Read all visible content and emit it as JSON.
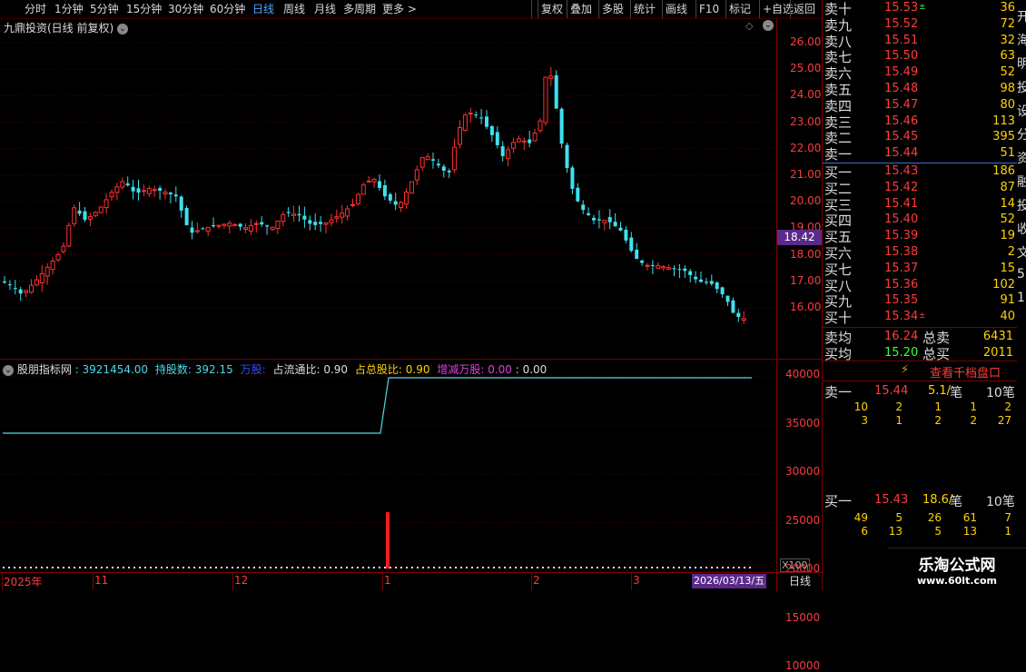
{
  "toolbar": {
    "periods": [
      "分时",
      "1分钟",
      "5分钟",
      "15分钟",
      "30分钟",
      "60分钟",
      "日线",
      "周线",
      "月线",
      "多周期",
      "更多 >"
    ],
    "active_period": "日线",
    "right_buttons": [
      "复权",
      "叠加",
      "多股",
      "统计",
      "画线",
      "F10",
      "标记",
      "+自选",
      "返回"
    ]
  },
  "chart": {
    "title": "九鼎投资(日线 前复权)",
    "price_axis": [
      "26.00",
      "25.00",
      "24.00",
      "23.00",
      "22.00",
      "21.00",
      "20.00",
      "19.00",
      "18.00",
      "17.00",
      "16.00"
    ],
    "current_price_tag": "18.42",
    "date_axis": [
      "2025年",
      "11",
      "12",
      "1",
      "2",
      "3"
    ],
    "cursor_date": "2026/03/13/五",
    "period_label": "日线"
  },
  "indicator": {
    "name": "股朋指标网",
    "value_main": ": 3921454.00",
    "holding_label": "持股数:",
    "holding_value": "392.15",
    "unit_label": "万股:",
    "float_ratio_label": "占流通比:",
    "float_ratio_value": "0.90",
    "total_ratio_label": "占总股比:",
    "total_ratio_value": "0.90",
    "change_label": "增减万股:",
    "change_value": "0.00",
    "extra_value": ": 0.00",
    "axis": [
      "40000",
      "35000",
      "30000",
      "25000",
      "20000",
      "15000",
      "10000"
    ],
    "scale_label": "X100"
  },
  "orderbook": {
    "asks": [
      {
        "label": "卖十",
        "price": "15.53",
        "vol": "36",
        "mark": "±"
      },
      {
        "label": "卖九",
        "price": "15.52",
        "vol": "72",
        "mark": ""
      },
      {
        "label": "卖八",
        "price": "15.51",
        "vol": "32",
        "mark": ""
      },
      {
        "label": "卖七",
        "price": "15.50",
        "vol": "63",
        "mark": ""
      },
      {
        "label": "卖六",
        "price": "15.49",
        "vol": "52",
        "mark": ""
      },
      {
        "label": "卖五",
        "price": "15.48",
        "vol": "98",
        "mark": ""
      },
      {
        "label": "卖四",
        "price": "15.47",
        "vol": "80",
        "mark": ""
      },
      {
        "label": "卖三",
        "price": "15.46",
        "vol": "113",
        "mark": ""
      },
      {
        "label": "卖二",
        "price": "15.45",
        "vol": "395",
        "mark": ""
      },
      {
        "label": "卖一",
        "price": "15.44",
        "vol": "51",
        "mark": ""
      }
    ],
    "bids": [
      {
        "label": "买一",
        "price": "15.43",
        "vol": "186",
        "mark": ""
      },
      {
        "label": "买二",
        "price": "15.42",
        "vol": "87",
        "mark": ""
      },
      {
        "label": "买三",
        "price": "15.41",
        "vol": "14",
        "mark": ""
      },
      {
        "label": "买四",
        "price": "15.40",
        "vol": "52",
        "mark": ""
      },
      {
        "label": "买五",
        "price": "15.39",
        "vol": "19",
        "mark": ""
      },
      {
        "label": "买六",
        "price": "15.38",
        "vol": "2",
        "mark": ""
      },
      {
        "label": "买七",
        "price": "15.37",
        "vol": "15",
        "mark": ""
      },
      {
        "label": "买八",
        "price": "15.36",
        "vol": "102",
        "mark": ""
      },
      {
        "label": "买九",
        "price": "15.35",
        "vol": "91",
        "mark": ""
      },
      {
        "label": "买十",
        "price": "15.34",
        "vol": "40",
        "mark": "±"
      }
    ],
    "avg_sell_label": "卖均",
    "avg_sell_price": "16.24",
    "total_sell_label": "总卖",
    "total_sell": "6431",
    "avg_buy_label": "买均",
    "avg_buy_price": "15.20",
    "total_buy_label": "总买",
    "total_buy": "2011",
    "view_button": "查看千档盘口",
    "sell1": {
      "label": "卖一",
      "price": "15.44",
      "per": "5.1/",
      "unit": "笔",
      "count": "10笔",
      "rows": [
        [
          "10",
          "2",
          "1",
          "1",
          "2"
        ],
        [
          "3",
          "1",
          "2",
          "2",
          "27"
        ]
      ]
    },
    "buy1": {
      "label": "买一",
      "price": "15.43",
      "per": "18.6/",
      "unit": "笔",
      "count": "10笔",
      "rows": [
        [
          "49",
          "5",
          "26",
          "61",
          "7"
        ],
        [
          "6",
          "13",
          "5",
          "13",
          "1"
        ]
      ]
    },
    "side_chars": [
      "开",
      "海",
      "明",
      "投",
      "设",
      "分",
      "资",
      "融",
      "投",
      "收",
      "文",
      "5",
      "1"
    ]
  },
  "watermark": {
    "name": "乐淘公式网",
    "url": "www.60lt.com"
  }
}
